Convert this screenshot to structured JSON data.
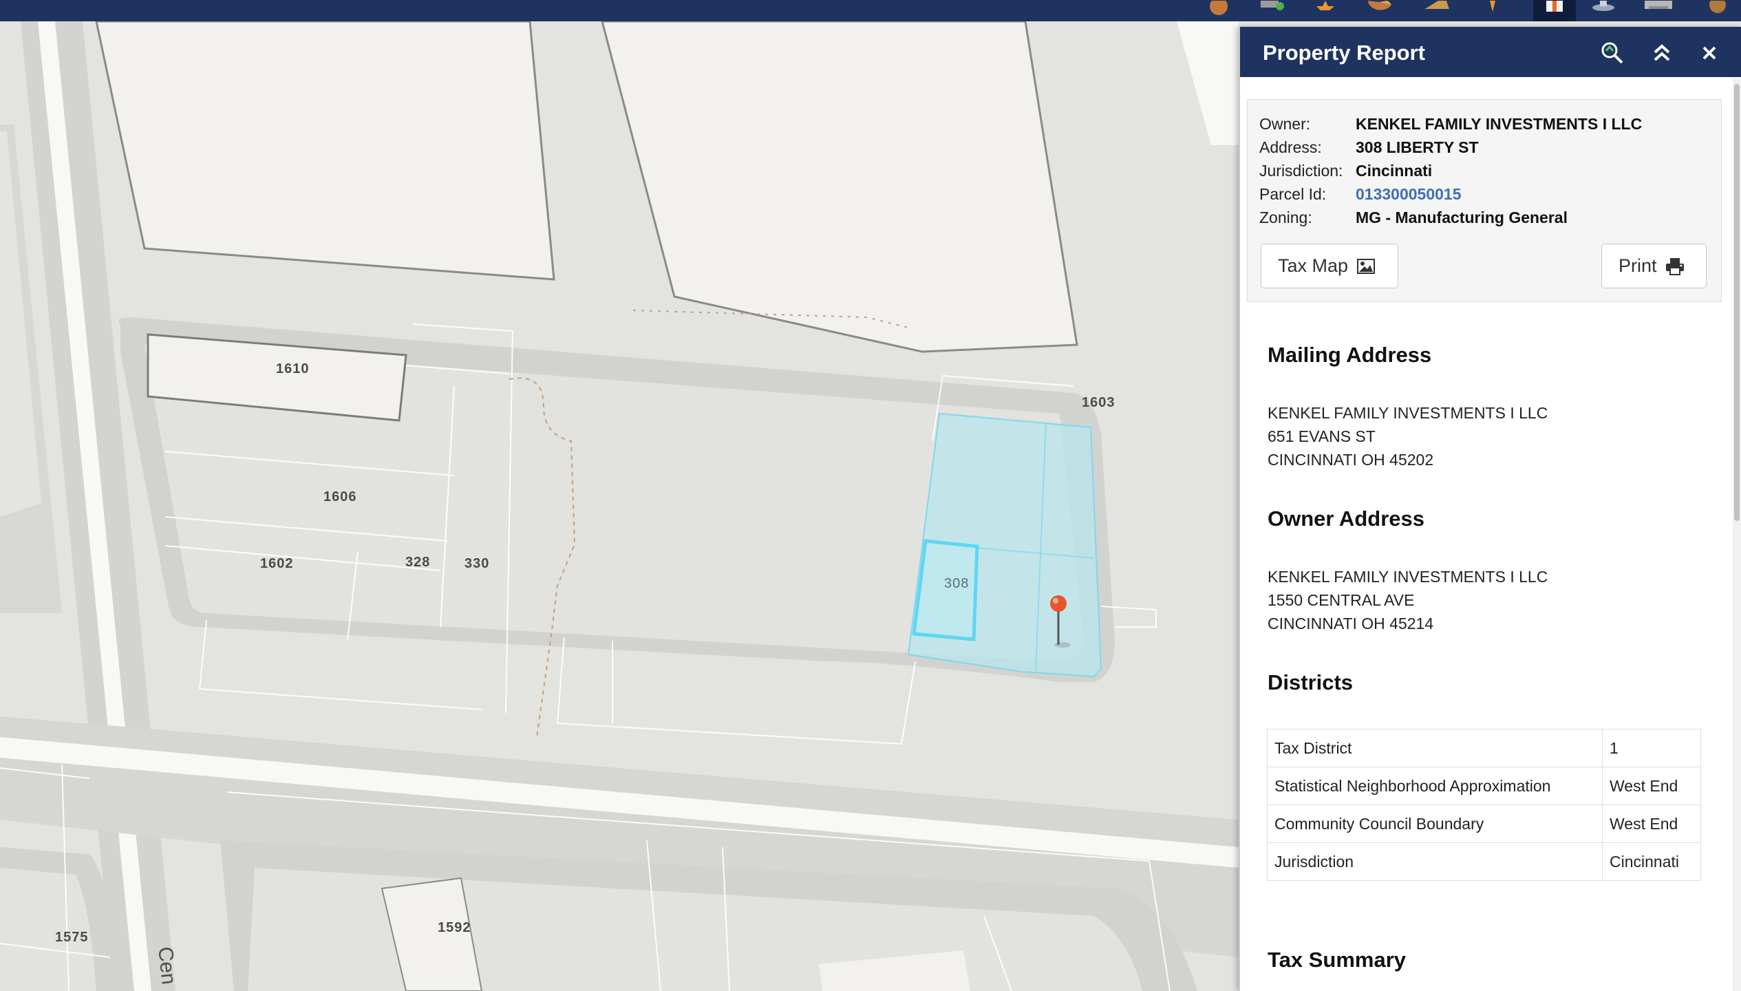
{
  "toolbar": {
    "icons": [
      "globe-icon",
      "add-layer-icon",
      "star-icon",
      "pie-chart-icon",
      "measure-icon",
      "locate-icon",
      "property-report-icon",
      "stamp-icon",
      "print-icon",
      "info-icon"
    ],
    "active_icon": "property-report-icon"
  },
  "map": {
    "parcel_labels": [
      "1610",
      "1603",
      "1606",
      "1602",
      "328",
      "330",
      "308",
      "1575",
      "1592"
    ],
    "street_label": "Cen",
    "selected_parcel": "308",
    "colors": {
      "selection_fill": "#b8e6ee",
      "selection_stroke": "#5fd6f2",
      "building": "#f2f1ee",
      "road": "#d4d4d1"
    }
  },
  "panel": {
    "title": "Property Report",
    "summary": {
      "fields": [
        {
          "key": "Owner:",
          "value": "KENKEL FAMILY INVESTMENTS I LLC"
        },
        {
          "key": "Address:",
          "value": "308 LIBERTY ST"
        },
        {
          "key": "Jurisdiction:",
          "value": "Cincinnati"
        },
        {
          "key": "Parcel Id:",
          "value": "013300050015"
        },
        {
          "key": "Zoning:",
          "value": "MG - Manufacturing General"
        }
      ],
      "tax_map_label": "Tax Map",
      "print_label": "Print"
    },
    "mailing": {
      "heading": "Mailing Address",
      "lines": [
        "KENKEL FAMILY INVESTMENTS I LLC",
        "651 EVANS ST",
        "CINCINNATI OH 45202"
      ]
    },
    "owner": {
      "heading": "Owner Address",
      "lines": [
        "KENKEL FAMILY INVESTMENTS I LLC",
        "1550 CENTRAL AVE",
        "CINCINNATI OH 45214"
      ]
    },
    "districts": {
      "heading": "Districts",
      "rows": [
        {
          "name": "Tax District",
          "value": "1"
        },
        {
          "name": "Statistical Neighborhood Approximation",
          "value": "West End"
        },
        {
          "name": "Community Council Boundary",
          "value": "West End"
        },
        {
          "name": "Jurisdiction",
          "value": "Cincinnati"
        }
      ]
    },
    "tax_summary_heading": "Tax Summary",
    "link_color": "#3f6fb5",
    "header_color": "#1f3360"
  }
}
